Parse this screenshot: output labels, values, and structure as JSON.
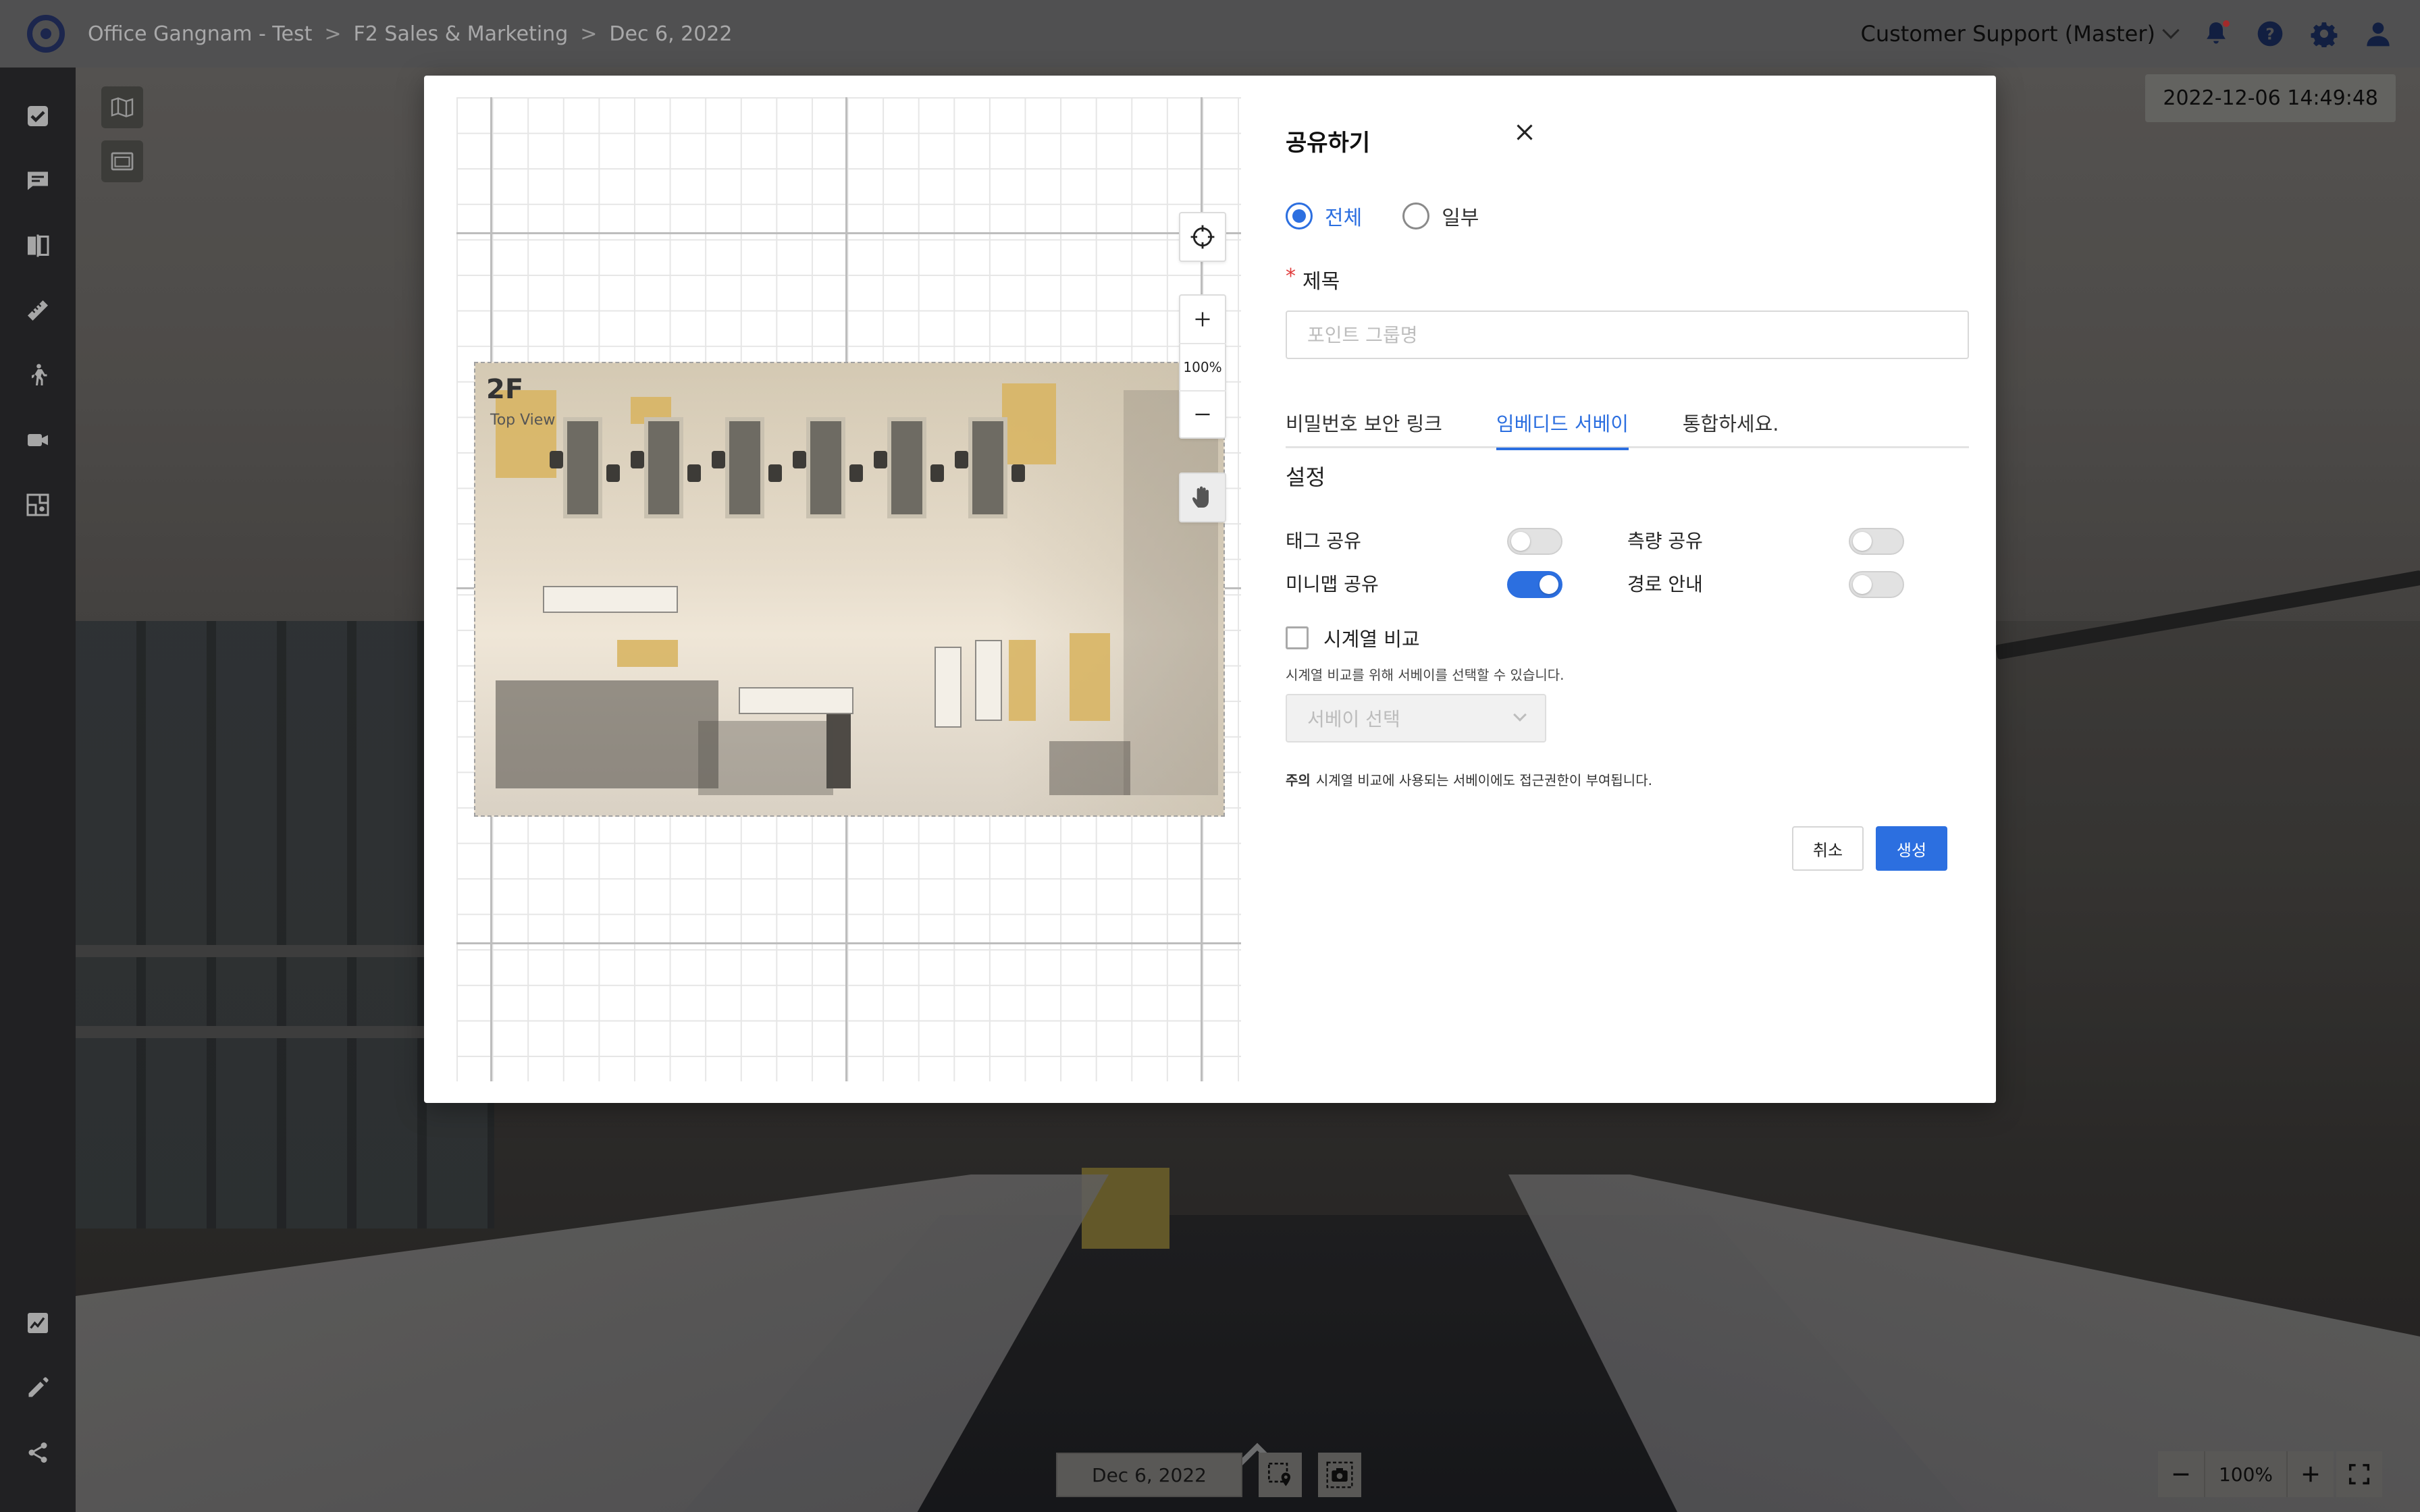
{
  "header": {
    "breadcrumbs": [
      "Office Gangnam - Test",
      "F2 Sales & Marketing",
      "Dec 6, 2022"
    ],
    "separator": ">",
    "user": "Customer Support (Master)"
  },
  "left_rail": {
    "items": [
      "check-square-icon",
      "comment-icon",
      "compare-icon",
      "ruler-icon",
      "walk-icon",
      "video-icon",
      "floorplan-icon"
    ],
    "bottom_items": [
      "chart-icon",
      "pencil-icon",
      "share-icon"
    ]
  },
  "viewer": {
    "timestamp": "2022-12-06 14:49:48",
    "bottom_date": "Dec 6, 2022",
    "zoom": "100%"
  },
  "modal": {
    "title": "공유하기",
    "scope_options": [
      {
        "label": "전체",
        "checked": true
      },
      {
        "label": "일부",
        "checked": false
      }
    ],
    "title_field": {
      "required_mark": "*",
      "label": "제목",
      "placeholder": "포인트 그룹명",
      "value": ""
    },
    "tabs": [
      {
        "label": "비밀번호 보안 링크",
        "active": false
      },
      {
        "label": "임베디드 서베이",
        "active": true
      },
      {
        "label": "통합하세요.",
        "active": false
      }
    ],
    "settings_title": "설정",
    "toggles": [
      {
        "label": "태그 공유",
        "on": false
      },
      {
        "label": "측량 공유",
        "on": false
      },
      {
        "label": "미니맵 공유",
        "on": true
      },
      {
        "label": "경로 안내",
        "on": false
      }
    ],
    "timeseries": {
      "label": "시계열 비교",
      "checked": false,
      "help": "시계열 비교를 위해 서베이를 선택할 수 있습니다.",
      "select_placeholder": "서베이 선택"
    },
    "note": {
      "prefix": "주의",
      "text": "시계열 비교에 사용되는 서베이에도 접근권한이 부여됩니다."
    },
    "cancel_label": "취소",
    "create_label": "생성",
    "map": {
      "zoom_label": "100%",
      "floor_label": "2F",
      "view_label": "Top View"
    }
  },
  "colors": {
    "accent": "#2c6fe0",
    "required": "#e03b3b",
    "topbar": "#6f6f71",
    "rail": "#2f2f31"
  }
}
